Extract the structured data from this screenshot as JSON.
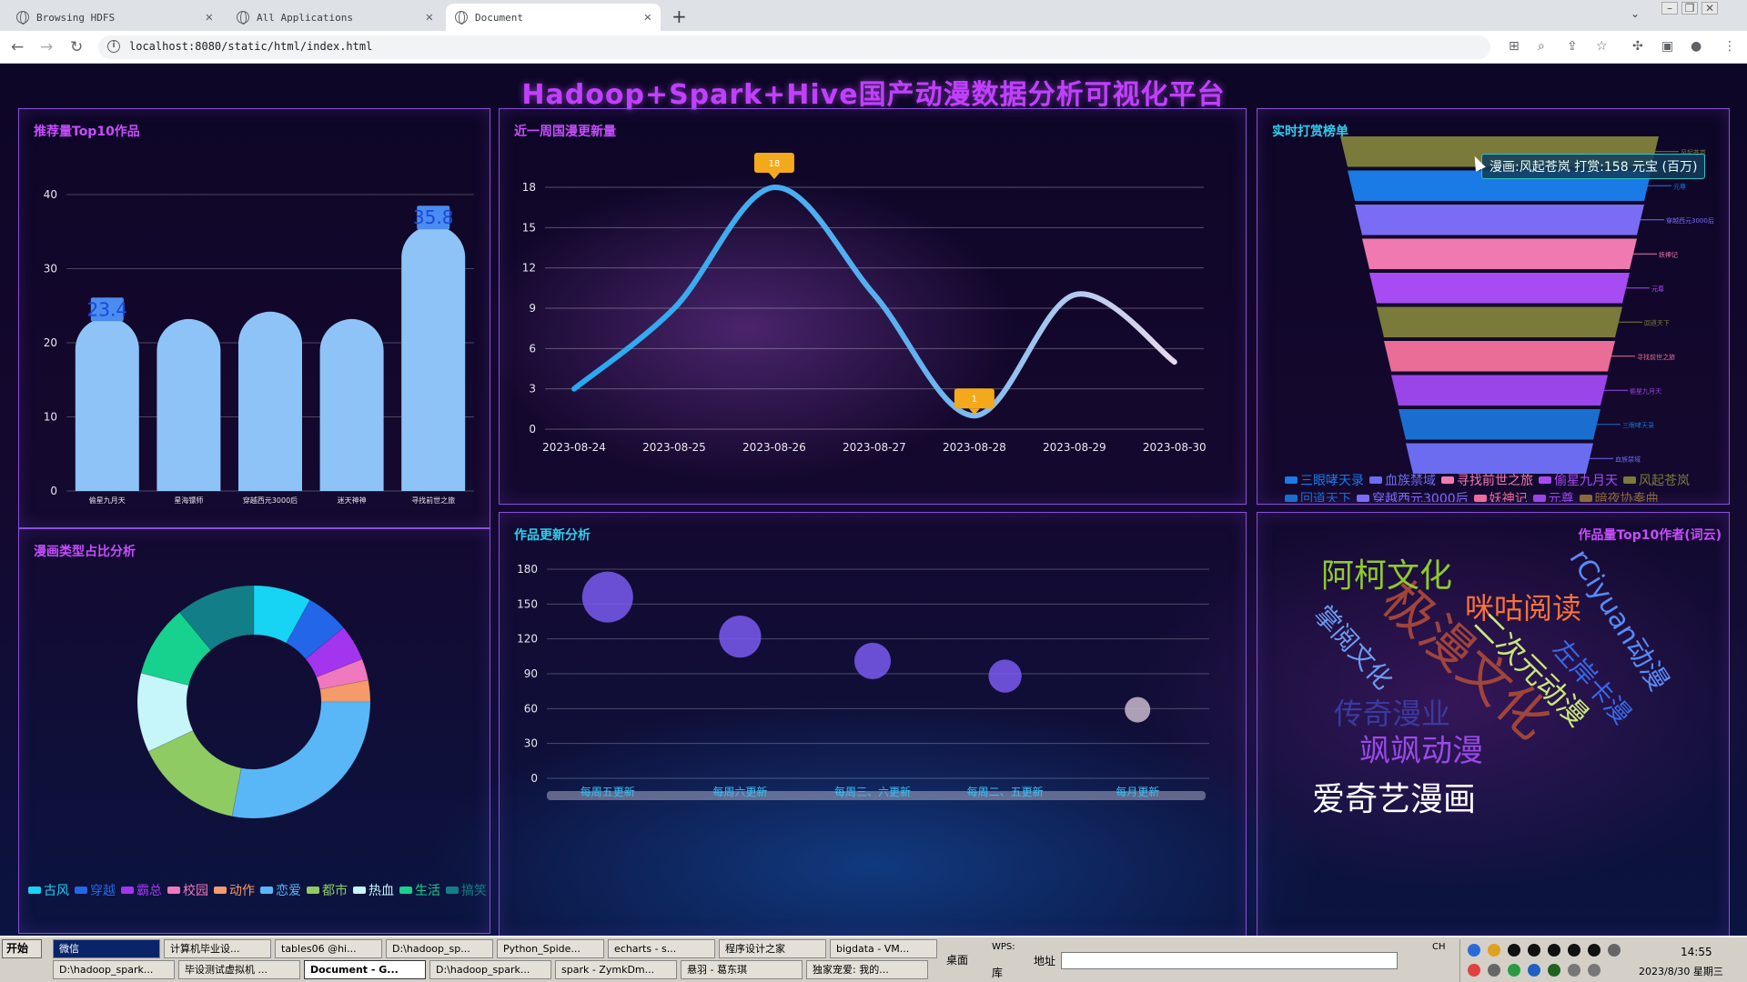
{
  "browser": {
    "tabs": [
      {
        "title": "Browsing HDFS",
        "active": false
      },
      {
        "title": "All Applications",
        "active": false
      },
      {
        "title": "Document",
        "active": true
      }
    ],
    "url": "localhost:8080/static/html/index.html"
  },
  "page": {
    "title": "Hadoop+Spark+Hive国产动漫数据分析可视化平台"
  },
  "panels": {
    "top10": {
      "title": "推荐量Top10作品",
      "chart_data": {
        "type": "bar",
        "categories": [
          "偷星九月天",
          "星海镖师",
          "穿越西元3000后",
          "迷天神神",
          "寻找前世之旅"
        ],
        "values": [
          23.4,
          23.2,
          24.2,
          23.2,
          35.8
        ],
        "data_labels": [
          "23.4",
          "",
          "",
          "",
          "35.8"
        ],
        "ylim": [
          0,
          40
        ],
        "yticks": [
          "0",
          "10",
          "20",
          "30",
          "40"
        ],
        "color": "#8ec3f7"
      }
    },
    "weekly": {
      "title": "近一周国漫更新量",
      "chart_data": {
        "type": "line",
        "categories": [
          "2023-08-24",
          "2023-08-25",
          "2023-08-26",
          "2023-08-27",
          "2023-08-28",
          "2023-08-29",
          "2023-08-30"
        ],
        "values": [
          3,
          9,
          18,
          10,
          1,
          10,
          5
        ],
        "ylim": [
          0,
          18
        ],
        "yticks": [
          "0",
          "3",
          "6",
          "9",
          "12",
          "15",
          "18"
        ],
        "markers": [
          {
            "index": 2,
            "label": "18"
          },
          {
            "index": 4,
            "label": "1"
          }
        ]
      }
    },
    "funnel": {
      "title": "实时打赏榜单",
      "tooltip": "漫画:风起苍岚 打赏:158 元宝 (百万)",
      "chart_data": {
        "type": "funnel",
        "categories": [
          "风起苍岚",
          "元尊",
          "穿越西元3000后",
          "妖神记",
          "元尊",
          "回道天下",
          "寻找前世之旅",
          "偷星九月天",
          "三眼哮天录",
          "血族禁域"
        ],
        "values": [
          158,
          150,
          145,
          140,
          135,
          130,
          125,
          120,
          115,
          110
        ],
        "colors": [
          "#7a7a3a",
          "#1a7ae6",
          "#7a6cf5",
          "#f07ab0",
          "#a64cf2",
          "#7a7a3a",
          "#e96d97",
          "#9a45e8",
          "#1a6ecf",
          "#6c6cf0"
        ]
      },
      "legend": [
        "三眼哮天录",
        "血族禁域",
        "寻找前世之旅",
        "偷星九月天",
        "风起苍岚",
        "回道天下",
        "穿越西元3000后",
        "妖神记",
        "元尊",
        "暗夜协奏曲"
      ],
      "legend_colors": [
        "#1a7ae6",
        "#6c6cf0",
        "#f07ab0",
        "#a64cf2",
        "#7a7a3a",
        "#1a6ecf",
        "#7a6cf5",
        "#e96d97",
        "#9a45e8",
        "#8a6a3a"
      ]
    },
    "genre": {
      "title": "漫画类型占比分析",
      "chart_data": {
        "type": "pie",
        "categories": [
          "古风",
          "穿越",
          "霸总",
          "校园",
          "动作",
          "恋爱",
          "都市",
          "热血",
          "生活",
          "搞笑"
        ],
        "values": [
          8,
          6,
          5,
          3,
          3,
          28,
          15,
          11,
          10,
          11
        ],
        "colors": [
          "#17d4f5",
          "#2466e8",
          "#a335ef",
          "#f078be",
          "#f59a6b",
          "#5ab7f7",
          "#8fcb63",
          "#c6f5fa",
          "#17d18f",
          "#127f88"
        ]
      }
    },
    "update": {
      "title": "作品更新分析",
      "chart_data": {
        "type": "scatter",
        "categories": [
          "每周五更新",
          "每周六更新",
          "每周三、六更新",
          "每周二、五更新",
          "每月更新"
        ],
        "values": [
          156,
          122,
          101,
          88,
          59
        ],
        "ylim": [
          0,
          180
        ],
        "yticks": [
          "0",
          "30",
          "60",
          "90",
          "120",
          "150",
          "180"
        ]
      }
    },
    "authors": {
      "title": "作品量Top10作者(词云)",
      "words": [
        {
          "text": "极漫文化",
          "color": "#a0453a"
        },
        {
          "text": "阿柯文化",
          "color": "#8fcb2a"
        },
        {
          "text": "咪咕阅读",
          "color": "#f5733a"
        },
        {
          "text": "rCiyuan动漫",
          "color": "#5a8af5"
        },
        {
          "text": "掌阅文化",
          "color": "#6c9cf0"
        },
        {
          "text": "二次元动漫",
          "color": "#c8e878"
        },
        {
          "text": "左岸卡漫",
          "color": "#3a68e8"
        },
        {
          "text": "传奇漫业",
          "color": "#3a3aa0"
        },
        {
          "text": "飒飒动漫",
          "color": "#9a4ae8"
        },
        {
          "text": "爱奇艺漫画",
          "color": "#ffffff"
        }
      ]
    }
  },
  "taskbar": {
    "start": "开始",
    "row1": [
      "微信",
      "计算机毕业设...",
      "tables06 @hi...",
      "D:\\hadoop_sp...",
      "Python_Spide...",
      "echarts - s...",
      "程序设计之家",
      "bigdata - VM..."
    ],
    "row2": [
      "D:\\hadoop_spark...",
      "毕设测试虚拟机 ...",
      "Document - G...",
      "D:\\hadoop_spark...",
      "spark - ZymkDm...",
      "悬羽 - 葛东琪",
      "独家宠爱: 我的..."
    ],
    "desktop": "桌面",
    "wps": "WPS:",
    "lib": "库",
    "address_label": "地址",
    "lang": "CH",
    "time": "14:55",
    "date": "2023/8/30 星期三"
  }
}
